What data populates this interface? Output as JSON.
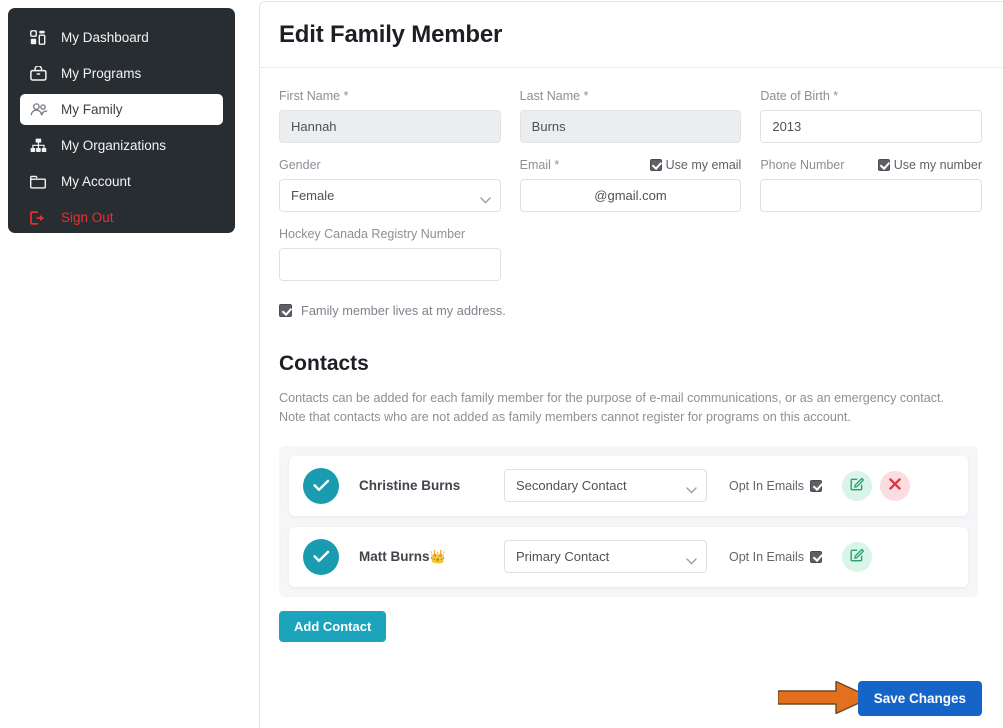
{
  "sidebar": {
    "items": [
      {
        "label": "My Dashboard",
        "icon": "dashboard-grid-icon",
        "active": false
      },
      {
        "label": "My Programs",
        "icon": "basket-icon",
        "active": false
      },
      {
        "label": "My Family",
        "icon": "people-icon",
        "active": true
      },
      {
        "label": "My Organizations",
        "icon": "org-tree-icon",
        "active": false
      },
      {
        "label": "My Account",
        "icon": "folder-icon",
        "active": false
      },
      {
        "label": "Sign Out",
        "icon": "sign-out-icon",
        "active": false
      }
    ]
  },
  "page": {
    "title": "Edit Family Member"
  },
  "form": {
    "first_name": {
      "label": "First Name *",
      "value": "Hannah"
    },
    "last_name": {
      "label": "Last Name *",
      "value": "Burns"
    },
    "dob": {
      "label": "Date of Birth *",
      "value": "2013"
    },
    "gender": {
      "label": "Gender",
      "value": "Female"
    },
    "email": {
      "label": "Email *",
      "value": "@gmail.com",
      "checkbox_label": "Use my email",
      "checked": true
    },
    "phone": {
      "label": "Phone Number",
      "value": "",
      "checkbox_label": "Use my number",
      "checked": true
    },
    "registry": {
      "label": "Hockey Canada Registry Number",
      "value": ""
    },
    "address_checkbox": {
      "label": "Family member lives at my address.",
      "checked": true
    }
  },
  "contacts": {
    "heading": "Contacts",
    "description": "Contacts can be added for each family member for the purpose of e-mail communications, or as an emergency contact. Note that contacts who are not added as family members cannot register for programs on this account.",
    "opt_in_label": "Opt In Emails",
    "add_button": "Add Contact",
    "rows": [
      {
        "name": "Christine Burns",
        "crown": "",
        "role": "Secondary Contact",
        "opt_in": true,
        "can_delete": true
      },
      {
        "name": "Matt Burns",
        "crown": "👑",
        "role": "Primary Contact",
        "opt_in": true,
        "can_delete": false
      }
    ]
  },
  "footer": {
    "save_label": "Save Changes"
  },
  "colors": {
    "sidebar_bg": "#282d31",
    "signout": "#ef2d2d",
    "teal": "#1a9cb0",
    "add_button": "#1ba4bb",
    "save_button": "#1565c9",
    "arrow": "#e2701e",
    "edit_green": "#28a06d",
    "delete_red": "#dc3545"
  }
}
